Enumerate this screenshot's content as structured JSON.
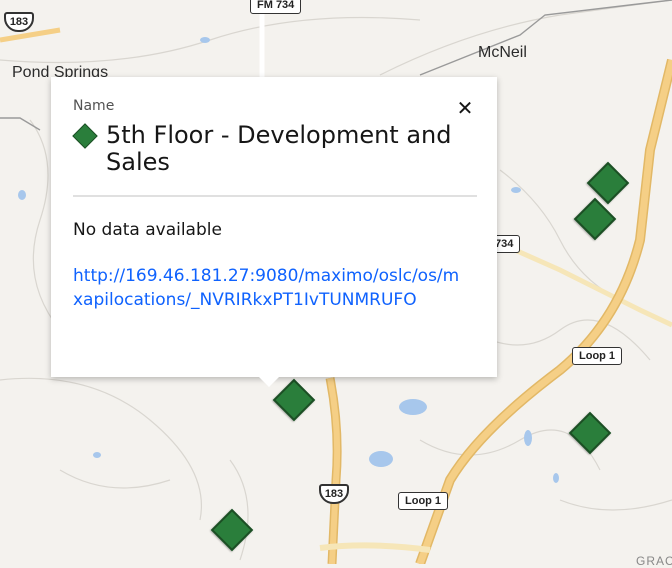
{
  "map": {
    "places": {
      "pond_springs": "Pond Springs",
      "mcneil": "McNeil"
    },
    "routes": {
      "us183_top": "183",
      "us183_bottom": "183",
      "fm734_top": "FM 734",
      "fm734_mid": "734",
      "loop1_right": "Loop 1",
      "loop1_bottom": "Loop 1"
    },
    "corner_label": "GRAC",
    "colors": {
      "land": "#f4f2ee",
      "highway": "#f3c97a",
      "water": "#a7c7ec",
      "marker": "#2a7e3b"
    },
    "marker_icon": "green-diamond-icon",
    "marker_count": 6
  },
  "popup": {
    "caption": "Name",
    "title": "5th Floor - Development and Sales",
    "close_icon": "close-icon",
    "status_text": "No data available",
    "link_text": "http://169.46.181.27:9080/maximo/oslc/os/mxapilocations/_NVRIRkxPT1IvTUNMRUFO"
  }
}
